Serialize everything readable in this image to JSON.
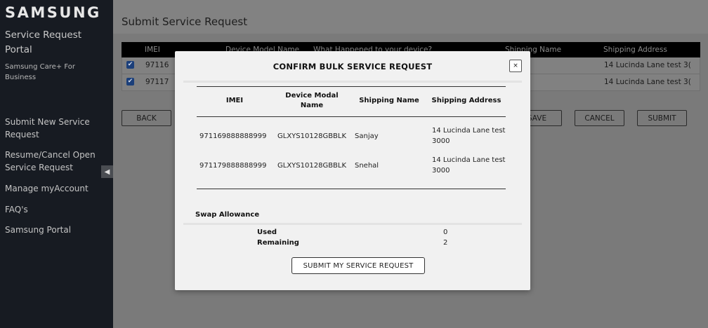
{
  "sidebar": {
    "logo": "SAMSUNG",
    "portal_title": "Service Request Portal",
    "portal_subtitle": "Samsung Care+ For Business",
    "nav": [
      {
        "label": "Submit New Service Request"
      },
      {
        "label": "Resume/Cancel Open Service Request"
      },
      {
        "label": "Manage myAccount"
      },
      {
        "label": "FAQ's"
      },
      {
        "label": "Samsung Portal"
      }
    ],
    "collapse_icon": "◀"
  },
  "main": {
    "title": "Submit Service Request",
    "table": {
      "headers": [
        "IMEI",
        "Device Model Name",
        "What Happened to your device?",
        "Shipping Name",
        "Shipping Address"
      ],
      "rows": [
        {
          "imei": "97116",
          "address": "14 Lucinda Lane test  3("
        },
        {
          "imei": "97117",
          "address": "14 Lucinda Lane test  3("
        }
      ]
    },
    "buttons": {
      "back": "BACK",
      "save": "SAVE",
      "cancel": "CANCEL",
      "submit": "SUBMIT"
    }
  },
  "modal": {
    "title": "CONFIRM BULK SERVICE REQUEST",
    "close_label": "×",
    "headers": {
      "imei": "IMEI",
      "model": "Device Modal Name",
      "shipping_name": "Shipping Name",
      "shipping_address": "Shipping Address"
    },
    "rows": [
      {
        "imei": "971169888888999",
        "model": "GLXYS10128GBBLK",
        "shipping_name": "Sanjay",
        "shipping_address": "14 Lucinda Lane test 3000"
      },
      {
        "imei": "971179888888999",
        "model": "GLXYS10128GBBLK",
        "shipping_name": "Snehal",
        "shipping_address": "14 Lucinda Lane test 3000"
      }
    ],
    "swap": {
      "title": "Swap Allowance",
      "used_label": "Used",
      "used_value": "0",
      "remaining_label": "Remaining",
      "remaining_value": "2"
    },
    "submit_label": "SUBMIT MY SERVICE REQUEST"
  },
  "colors": {
    "sidebar_bg": "#171b22",
    "overlay": "#7a7a7a",
    "modal_bg": "#f1f1f1",
    "checkbox": "#1b3f7a"
  }
}
